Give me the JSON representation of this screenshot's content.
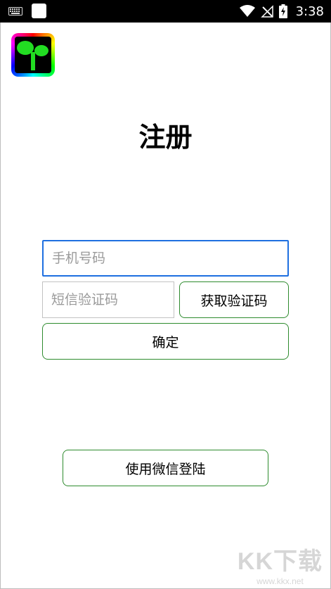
{
  "status_bar": {
    "time": "3:38",
    "icons": [
      "keyboard-icon",
      "app-notification-icon",
      "wifi-icon",
      "no-signal-icon",
      "battery-charging-icon"
    ]
  },
  "app": {
    "logo_icon": "sprout-logo-icon"
  },
  "page": {
    "title": "注册"
  },
  "form": {
    "phone_placeholder": "手机号码",
    "sms_code_placeholder": "短信验证码",
    "get_code_label": "获取验证码",
    "confirm_label": "确定"
  },
  "alt_login": {
    "wechat_label": "使用微信登陆"
  },
  "watermark": {
    "logo_text": "KK下载",
    "url": "www.kkx.net"
  },
  "colors": {
    "focus_border": "#1e6fe0",
    "button_border": "#2e8b2e",
    "status_bar_bg": "#000000"
  }
}
